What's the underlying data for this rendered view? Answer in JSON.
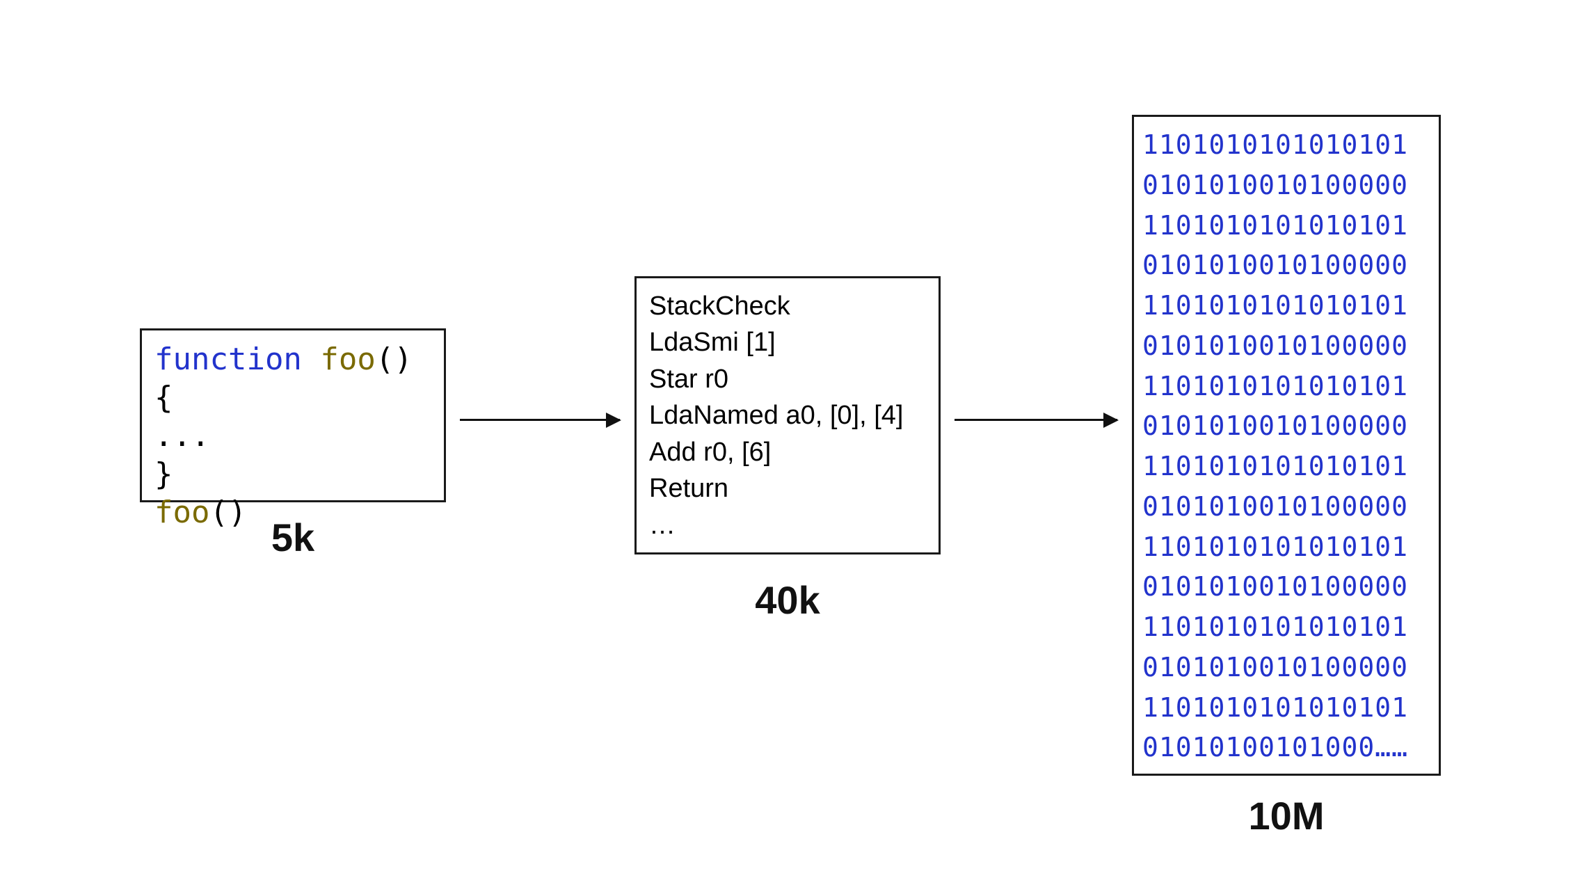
{
  "source": {
    "label": "5k",
    "line1_kw": "function",
    "line1_space": " ",
    "line1_fn": "foo",
    "line1_rest": "() {",
    "line2": "...",
    "line3": "}",
    "line4_fn": "foo",
    "line4_rest": "()"
  },
  "bytecode": {
    "label": "40k",
    "lines": [
      "StackCheck",
      "LdaSmi [1]",
      "Star r0",
      "LdaNamed a0, [0], [4]",
      "Add r0, [6]",
      "Return",
      "…"
    ]
  },
  "machine": {
    "label": "10M",
    "lines": [
      "1101010101010101",
      "0101010010100000",
      "1101010101010101",
      "0101010010100000",
      "1101010101010101",
      "0101010010100000",
      "1101010101010101",
      "0101010010100000",
      "1101010101010101",
      "0101010010100000",
      "1101010101010101",
      "0101010010100000",
      "1101010101010101",
      "0101010010100000",
      "1101010101010101",
      "01010100101000……"
    ]
  }
}
